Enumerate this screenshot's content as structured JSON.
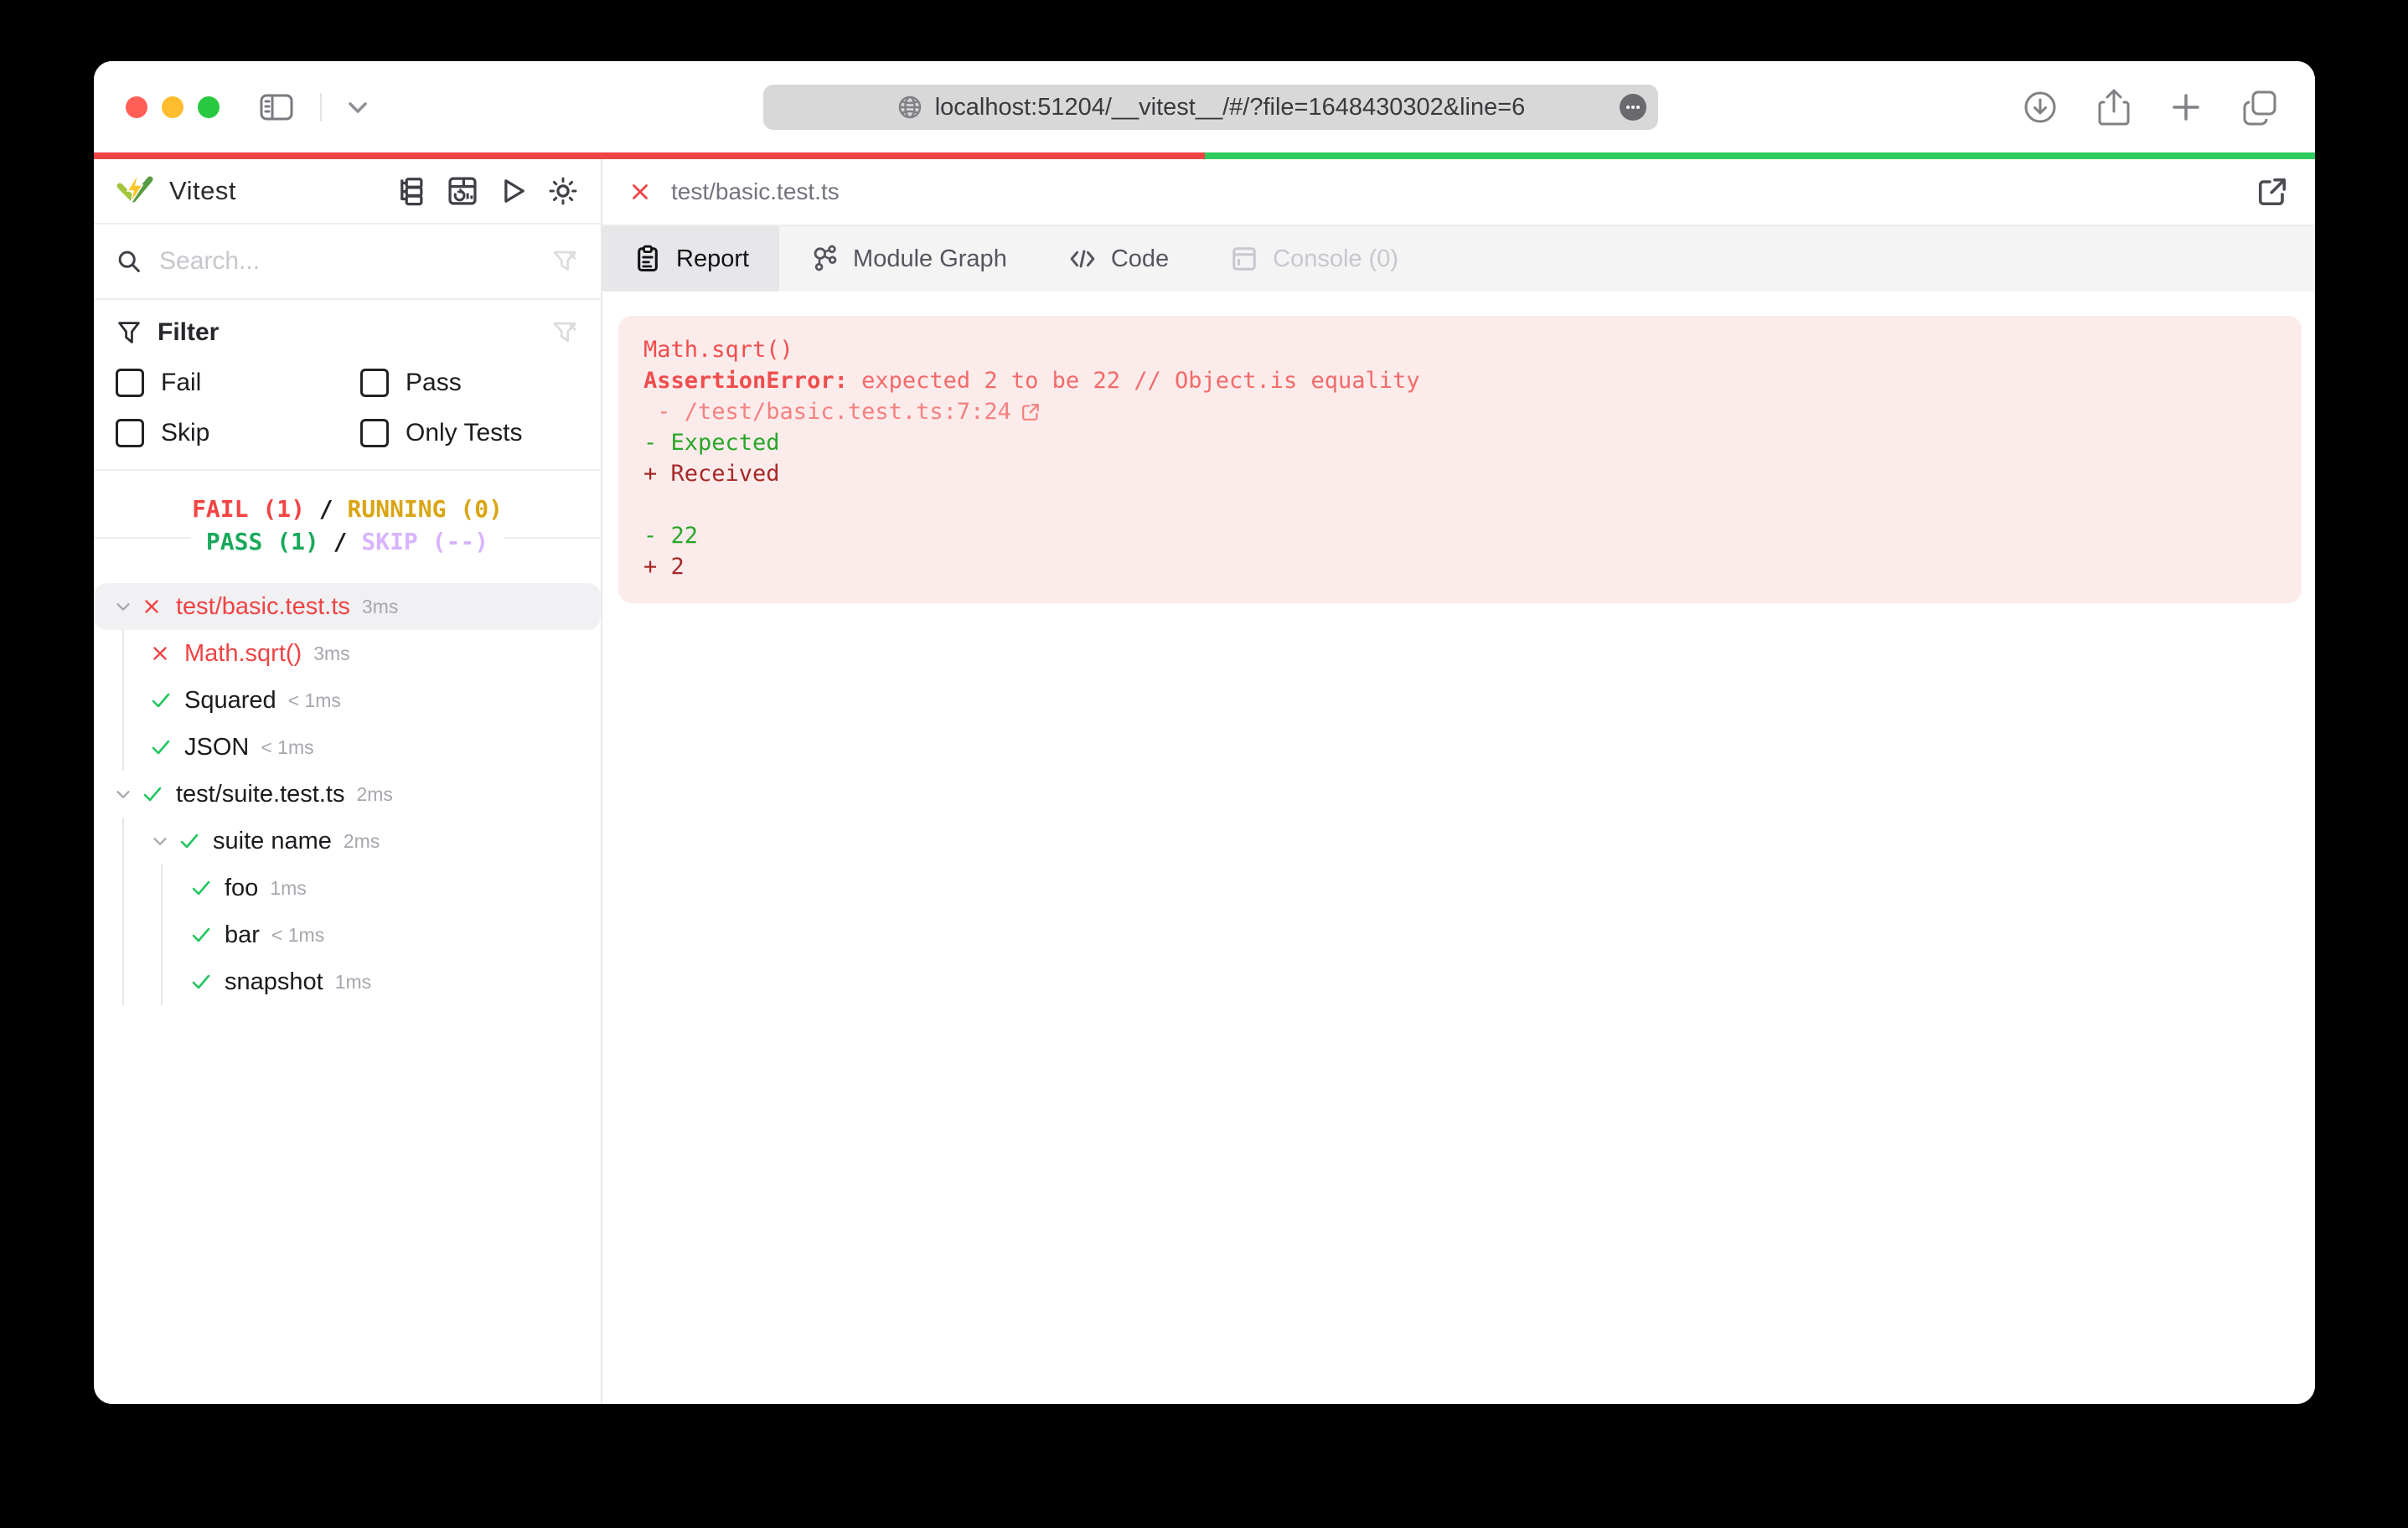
{
  "browser": {
    "url": "localhost:51204/__vitest__/#/?file=1648430302&line=6",
    "traffic_lights": {
      "close": "#ff5f57",
      "minimize": "#febc2e",
      "zoom": "#28c840"
    }
  },
  "progress": {
    "fail_color": "#ef4444",
    "pass_color": "#2ecc5e",
    "fail_fraction": "50%"
  },
  "sidebar": {
    "title": "Vitest",
    "search_placeholder": "Search...",
    "filter": {
      "label": "Filter",
      "options": [
        {
          "label": "Fail"
        },
        {
          "label": "Pass"
        },
        {
          "label": "Skip"
        },
        {
          "label": "Only Tests"
        }
      ]
    },
    "summary": {
      "fail": "FAIL (1)",
      "running": "RUNNING (0)",
      "pass": "PASS (1)",
      "skip": "SKIP (--)",
      "separator": "/",
      "colors": {
        "fail": "#f24444",
        "running": "#d9a514",
        "pass": "#1aa95c",
        "skip": "#d8b4fe"
      }
    },
    "tree": [
      {
        "label": "test/basic.test.ts",
        "duration": "3ms",
        "status": "fail",
        "level": 0,
        "chevron": true,
        "selected": true
      },
      {
        "label": "Math.sqrt()",
        "duration": "3ms",
        "status": "fail",
        "level": 1,
        "chevron": false,
        "selected": false
      },
      {
        "label": "Squared",
        "duration": "< 1ms",
        "status": "pass",
        "level": 1,
        "chevron": false,
        "selected": false
      },
      {
        "label": "JSON",
        "duration": "< 1ms",
        "status": "pass",
        "level": 1,
        "chevron": false,
        "selected": false
      },
      {
        "label": "test/suite.test.ts",
        "duration": "2ms",
        "status": "pass",
        "level": 0,
        "chevron": true,
        "selected": false
      },
      {
        "label": "suite name",
        "duration": "2ms",
        "status": "pass",
        "level": 1,
        "chevron": true,
        "selected": false
      },
      {
        "label": "foo",
        "duration": "1ms",
        "status": "pass",
        "level": 2,
        "chevron": false,
        "selected": false
      },
      {
        "label": "bar",
        "duration": "< 1ms",
        "status": "pass",
        "level": 2,
        "chevron": false,
        "selected": false
      },
      {
        "label": "snapshot",
        "duration": "1ms",
        "status": "pass",
        "level": 2,
        "chevron": false,
        "selected": false
      }
    ]
  },
  "main": {
    "file_tab": "test/basic.test.ts",
    "tabs": [
      {
        "label": "Report",
        "state": "active"
      },
      {
        "label": "Module Graph",
        "state": "normal"
      },
      {
        "label": "Code",
        "state": "normal"
      },
      {
        "label": "Console (0)",
        "state": "disabled"
      }
    ],
    "report_lines": [
      {
        "type": "title",
        "prefix": "",
        "text": "Math.sqrt()"
      },
      {
        "type": "error",
        "prefix": "AssertionError:",
        "text": " expected 2 to be 22 // Object.is equality"
      },
      {
        "type": "link",
        "prefix": "",
        "text": " - /test/basic.test.ts:7:24"
      },
      {
        "type": "del",
        "prefix": "",
        "text": "- Expected"
      },
      {
        "type": "add",
        "prefix": "",
        "text": "+ Received"
      },
      {
        "type": "blank",
        "prefix": "",
        "text": ""
      },
      {
        "type": "del",
        "prefix": "",
        "text": "- 22"
      },
      {
        "type": "add",
        "prefix": "",
        "text": "+ 2"
      }
    ]
  }
}
